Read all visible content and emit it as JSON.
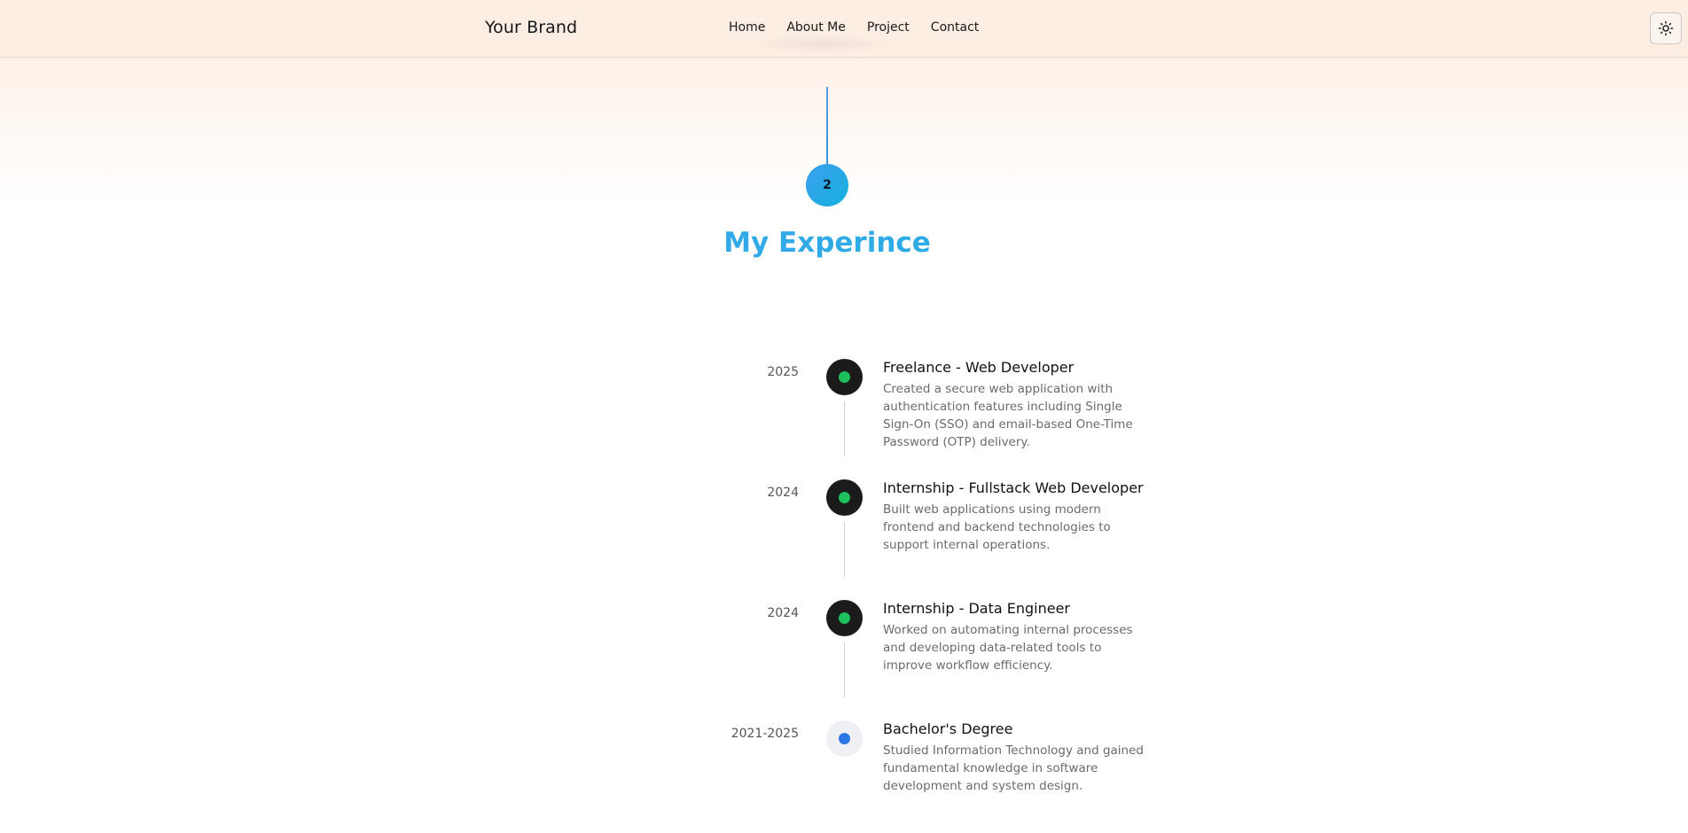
{
  "navbar": {
    "brand": "Your Brand",
    "links": [
      "Home",
      "About Me",
      "Project",
      "Contact"
    ],
    "theme_toggle_icon": "sun-icon"
  },
  "section": {
    "number": "2",
    "title": "My Experince"
  },
  "timeline": [
    {
      "year": "2025",
      "title": "Freelance - Web Developer",
      "description": "Created a secure web application with authentication features including Single Sign-On (SSO) and email-based One-Time Password (OTP) delivery.",
      "status": "done"
    },
    {
      "year": "2024",
      "title": "Internship - Fullstack Web Developer",
      "description": "Built web applications using modern frontend and backend technologies to support internal operations.",
      "status": "done"
    },
    {
      "year": "2024",
      "title": "Internship - Data Engineer",
      "description": "Worked on automating internal processes and developing data-related tools to improve workflow efficiency.",
      "status": "done"
    },
    {
      "year": "2021-2025",
      "title": "Bachelor's Degree",
      "description": "Studied Information Technology and gained fundamental knowledge in software development and system design.",
      "status": "education"
    }
  ],
  "colors": {
    "accent_start": "#4aa3ef",
    "accent_end": "#15b2df",
    "dot_green": "#1fbf5c",
    "dot_blue": "#2b77e6"
  }
}
